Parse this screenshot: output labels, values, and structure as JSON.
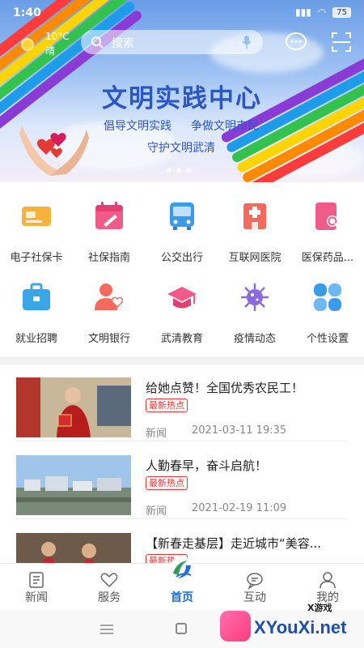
{
  "status": {
    "time": "1:40",
    "battery": "75"
  },
  "weather": {
    "temp": "10°C",
    "condition": "晴"
  },
  "search": {
    "placeholder": "搜索"
  },
  "banner": {
    "title": "文明实践中心",
    "slogan1": "倡导文明实践",
    "slogan2": "争做文明市民",
    "slogan3": "守护文明武清"
  },
  "grid": [
    {
      "label": "电子社保卡",
      "icon": "social-card-icon",
      "color": "#f6b23a"
    },
    {
      "label": "社保指南",
      "icon": "calendar-guide-icon",
      "color": "#f05b8a"
    },
    {
      "label": "公交出行",
      "icon": "bus-icon",
      "color": "#3a9be9"
    },
    {
      "label": "互联网医院",
      "icon": "hospital-icon",
      "color": "#f46b5d"
    },
    {
      "label": "医保药品...",
      "icon": "medicine-search-icon",
      "color": "#f05b8a"
    },
    {
      "label": "就业招聘",
      "icon": "briefcase-icon",
      "color": "#3aa6e8"
    },
    {
      "label": "文明银行",
      "icon": "user-heart-icon",
      "color": "#f46b5d"
    },
    {
      "label": "武清教育",
      "icon": "graduation-cap-icon",
      "color": "#f05b8a"
    },
    {
      "label": "疫情动态",
      "icon": "virus-icon",
      "color": "#8b6ae0"
    },
    {
      "label": "个性设置",
      "icon": "settings-grid-icon",
      "color": "#3a9be9"
    }
  ],
  "news": [
    {
      "title": "给她点赞！全国优秀农民工！",
      "tag": "最新热点",
      "source": "新闻",
      "date": "2021-03-11 19:35"
    },
    {
      "title": "人勤春早，奋斗启航！",
      "tag": "最新热点",
      "source": "新闻",
      "date": "2021-02-19 11:09"
    },
    {
      "title": "【新春走基层】走近城市“美容...",
      "tag": "最新热点"
    }
  ],
  "tabs": [
    {
      "label": "新闻",
      "icon": "news-icon"
    },
    {
      "label": "服务",
      "icon": "heart-icon"
    },
    {
      "label": "首页",
      "icon": "home-logo-icon"
    },
    {
      "label": "互动",
      "icon": "chat-icon"
    },
    {
      "label": "我的",
      "icon": "user-icon"
    }
  ],
  "watermark": {
    "text": "XYouXi.net",
    "sub": "X游戏"
  },
  "colors": {
    "accent": "#1e6fd9",
    "tag": "#e53935",
    "title": "#2a56c6"
  }
}
